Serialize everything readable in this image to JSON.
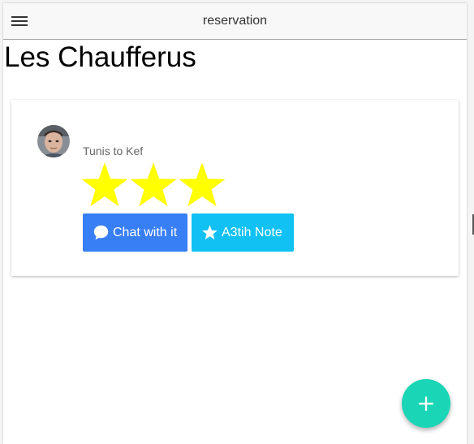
{
  "toolbar": {
    "title": "reservation",
    "menu_icon": "hamburger-menu-icon"
  },
  "page": {
    "title": "Les Chaufferus"
  },
  "card": {
    "avatar_icon": "driver-avatar",
    "route": "Tunis to Kef",
    "rating": 3,
    "star_color": "#ffff00",
    "buttons": {
      "chat": {
        "label": "Chat with it",
        "icon": "chat-bubble-icon",
        "color": "#387ef5"
      },
      "note": {
        "label": "A3tih Note",
        "icon": "star-icon",
        "color": "#11c1f3"
      }
    }
  },
  "fab": {
    "label": "+",
    "color": "#1bd6b6"
  }
}
